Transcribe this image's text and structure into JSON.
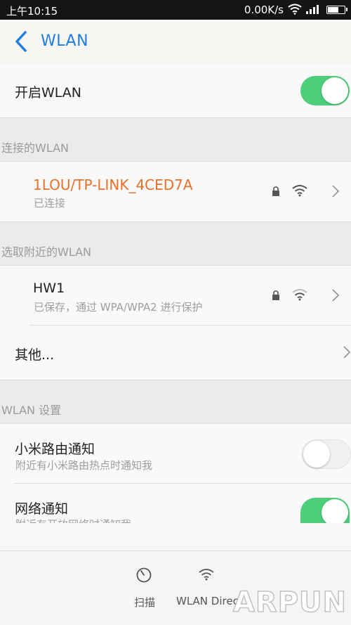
{
  "status_bar": {
    "time": "上午10:15",
    "net_speed": "0.00K/s",
    "icons": [
      "wifi-icon",
      "signal-icon",
      "battery-icon"
    ]
  },
  "header": {
    "back_icon": "back-chevron-icon",
    "title": "WLAN"
  },
  "enable_wlan": {
    "label": "开启WLAN",
    "state": "on"
  },
  "connected_section": {
    "title": "连接的WLAN"
  },
  "connected_network": {
    "ssid": "1LOU/TP-LINK_4CED7A",
    "status": "已连接",
    "locked": true
  },
  "nearby_section": {
    "title": "选取附近的WLAN"
  },
  "nearby_networks": [
    {
      "ssid": "HW1",
      "status": "已保存，通过 WPA/WPA2 进行保护",
      "locked": true
    }
  ],
  "other": {
    "label": "其他..."
  },
  "settings_section": {
    "title": "WLAN 设置"
  },
  "xiaomi_router_notify": {
    "label": "小米路由通知",
    "desc": "附近有小米路由热点时通知我",
    "state": "off"
  },
  "network_notify": {
    "label": "网络通知",
    "desc": "附近有开放网络时通知我",
    "state": "on"
  },
  "bottom_bar": {
    "scan_label": "扫描",
    "wlan_direct_label": "WLAN Direct"
  },
  "watermark": "ARPUN",
  "colors": {
    "accent": "#1e7ee0",
    "connected": "#e8702a",
    "toggle_on": "#4dd07a"
  }
}
